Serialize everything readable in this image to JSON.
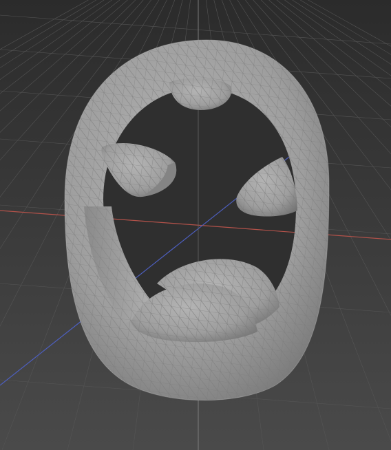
{
  "viewport": {
    "background_top": "#2b2b2b",
    "background_bottom": "#4a4a4a",
    "grid_color": "#555555",
    "axis_x_color": "#b4524a",
    "axis_y_color": "#4d5fbf",
    "axis_z_color": "#888888",
    "mesh_fill": "#9e9e9e",
    "mesh_wire": "#7a7a7a",
    "mesh_shadow": "#6e6e6e",
    "cavity_color": "#2f2f2f"
  },
  "object": {
    "type": "mesh",
    "shape": "ring-torus-with-cutouts",
    "display": "wireframe-on-shaded"
  }
}
